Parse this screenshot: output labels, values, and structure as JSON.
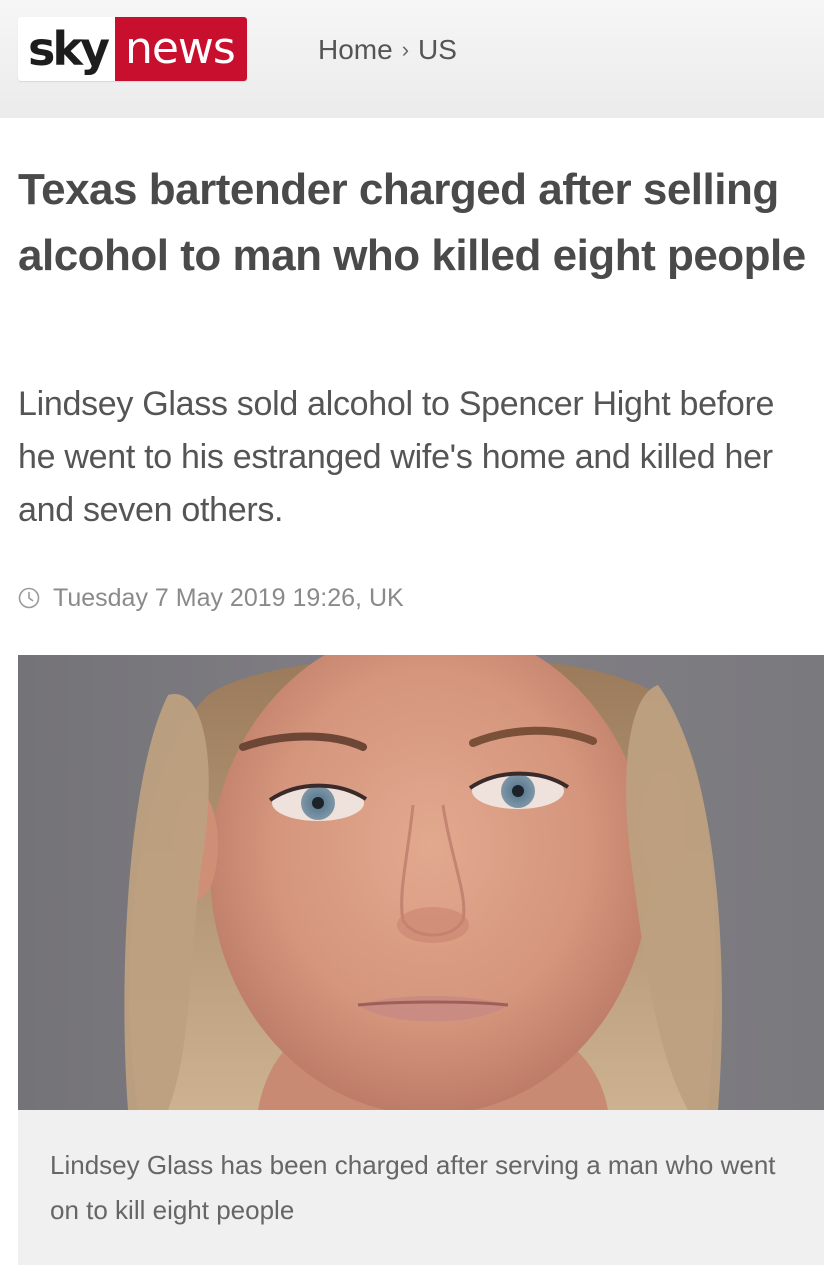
{
  "header": {
    "logo_sky": "sky",
    "logo_news": "news",
    "breadcrumb": [
      "Home",
      "US"
    ],
    "breadcrumb_separator": "›"
  },
  "article": {
    "headline": "Texas bartender charged after selling alcohol to man who killed eight people",
    "standfirst": "Lindsey Glass sold alcohol to Spencer Hight before he went to his estranged wife's home and killed her and seven others.",
    "timestamp": "Tuesday 7 May 2019 19:26, UK",
    "image_caption": "Lindsey Glass has been charged after serving a man who went on to kill eight people"
  },
  "icons": {
    "timestamp": "clock-icon"
  },
  "colors": {
    "brand_red": "#c8102e",
    "headline_text": "#4a4a4a",
    "body_text": "#555555",
    "meta_text": "#8a8a8a",
    "caption_bg": "#f0f0f0"
  }
}
